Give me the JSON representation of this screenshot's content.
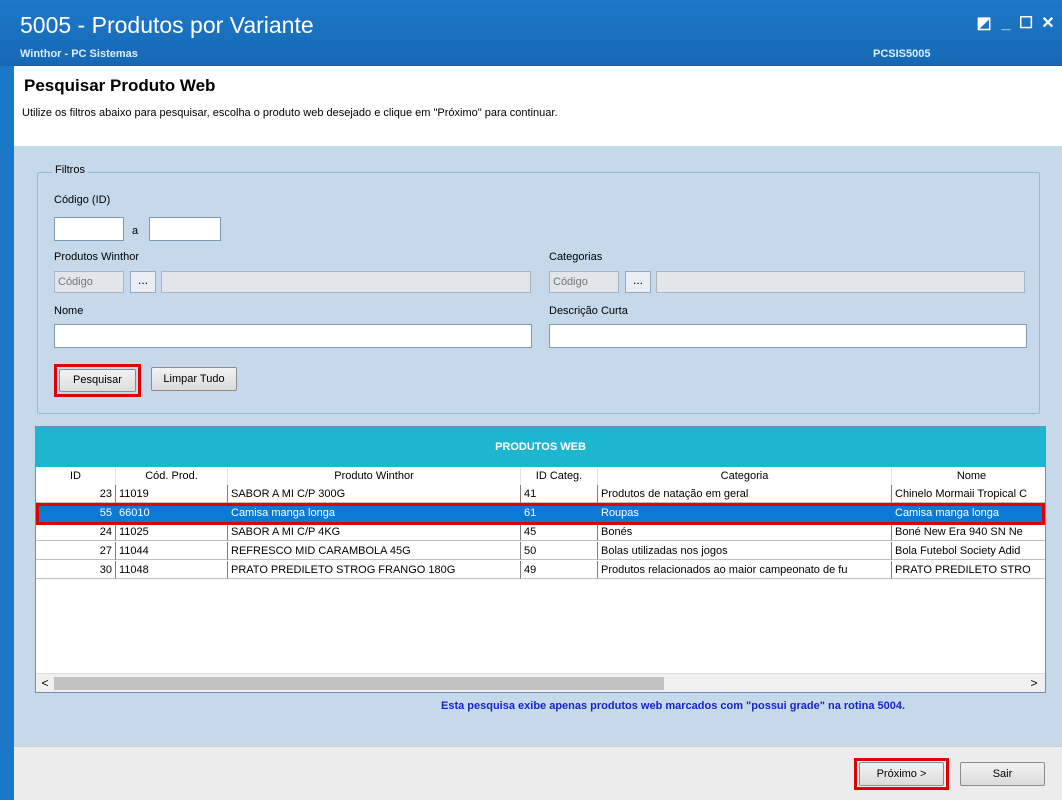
{
  "window": {
    "title": "5005 - Produtos por Variante",
    "vendor": "Winthor - PC Sistemas",
    "routine_code": "PCSIS5005",
    "controls": {
      "restore": "◩",
      "minimize": "_",
      "maximize": "☐",
      "close": "✕"
    }
  },
  "header": {
    "title": "Pesquisar Produto Web",
    "description": "Utilize os filtros abaixo para pesquisar, escolha o produto web desejado e clique em \"Próximo\" para continuar."
  },
  "filters": {
    "legend": "Filtros",
    "codigo_label": "Código (ID)",
    "codigo_from": "",
    "codigo_to": "",
    "range_sep": "a",
    "produtos_winthor_label": "Produtos Winthor",
    "produtos_winthor_code_placeholder": "Código",
    "produtos_winthor_desc": "",
    "categorias_label": "Categorias",
    "categorias_code_placeholder": "Código",
    "categorias_desc": "",
    "lookup_button": "...",
    "nome_label": "Nome",
    "nome_value": "",
    "descricao_curta_label": "Descrição Curta",
    "descricao_curta_value": "",
    "search_button": "Pesquisar",
    "clear_button": "Limpar Tudo"
  },
  "grid": {
    "title": "PRODUTOS WEB",
    "columns": [
      "ID",
      "Cód. Prod.",
      "Produto Winthor",
      "ID Categ.",
      "Categoria",
      "Nome"
    ],
    "rows": [
      [
        "23",
        "11019",
        "SABOR A MI C/P 300G",
        "41",
        "Produtos de natação em geral",
        "Chinelo Mormaii Tropical C"
      ],
      [
        "55",
        "66010",
        "Camisa manga longa",
        "61",
        "Roupas",
        "Camisa manga longa"
      ],
      [
        "24",
        "11025",
        "SABOR A MI C/P 4KG",
        "45",
        "Bonés",
        "Boné New Era 940 SN Ne"
      ],
      [
        "27",
        "11044",
        "REFRESCO MID CARAMBOLA 45G",
        "50",
        "Bolas utilizadas nos jogos",
        "Bola Futebol Society Adid"
      ],
      [
        "30",
        "11048",
        "PRATO PREDILETO STROG FRANGO 180G",
        "49",
        "Produtos relacionados ao maior campeonato de fu",
        "PRATO PREDILETO STRO"
      ]
    ],
    "selected_row": 1,
    "scroll_left": "<",
    "scroll_right": ">"
  },
  "note": "Esta pesquisa exibe apenas produtos web marcados com \"possui grade\" na rotina 5004.",
  "footer": {
    "next_button": "Próximo >",
    "exit_button": "Sair"
  }
}
